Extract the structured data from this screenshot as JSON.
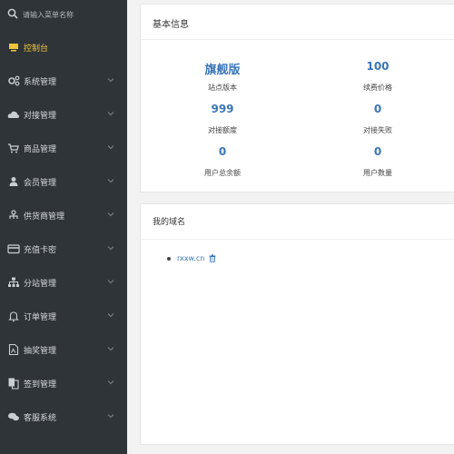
{
  "sidebar": {
    "search_placeholder": "请输入菜单名称",
    "items": [
      {
        "label": "控制台",
        "icon": "monitor-icon",
        "active": true
      },
      {
        "label": "系统管理",
        "icon": "gears-icon"
      },
      {
        "label": "对接管理",
        "icon": "cloud-icon"
      },
      {
        "label": "商品管理",
        "icon": "cart-icon"
      },
      {
        "label": "会员管理",
        "icon": "user-icon"
      },
      {
        "label": "供货商管理",
        "icon": "supplier-icon"
      },
      {
        "label": "充值卡密",
        "icon": "card-icon"
      },
      {
        "label": "分站管理",
        "icon": "sitemap-icon"
      },
      {
        "label": "订单管理",
        "icon": "bell-icon"
      },
      {
        "label": "抽奖管理",
        "icon": "document-icon"
      },
      {
        "label": "签到管理",
        "icon": "copy-icon"
      },
      {
        "label": "客服系统",
        "icon": "chat-icon"
      }
    ]
  },
  "basic_info": {
    "title": "基本信息",
    "stats": [
      {
        "value": "旗舰版",
        "label": "站点版本"
      },
      {
        "value": "100",
        "label": "续费价格"
      },
      {
        "value": "999",
        "label": "对接额度"
      },
      {
        "value": "0",
        "label": "对接失败"
      },
      {
        "value": "0",
        "label": "用户总余额"
      },
      {
        "value": "0",
        "label": "用户数量"
      }
    ]
  },
  "domains": {
    "title": "我的域名",
    "items": [
      "rxxw.cn"
    ]
  },
  "colors": {
    "sidebar_bg": "#2f3439",
    "accent_blue": "#3b76b8",
    "active_yellow": "#f0c43a"
  }
}
